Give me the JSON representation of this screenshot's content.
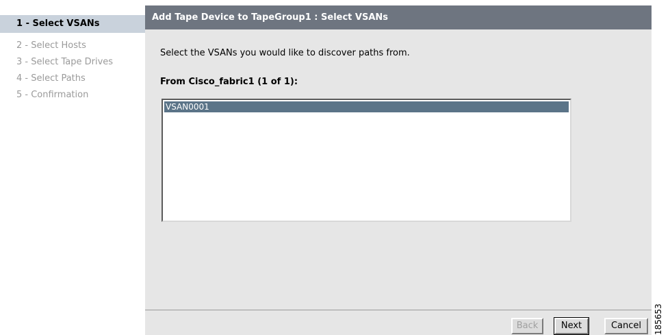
{
  "wizard": {
    "steps": [
      {
        "label": "1 - Select VSANs",
        "active": true
      },
      {
        "label": "2 - Select Hosts",
        "active": false
      },
      {
        "label": "3 - Select Tape Drives",
        "active": false
      },
      {
        "label": "4 - Select Paths",
        "active": false
      },
      {
        "label": "5 - Confirmation",
        "active": false
      }
    ]
  },
  "panel": {
    "title": "Add Tape Device to TapeGroup1 : Select VSANs",
    "instruction": "Select the VSANs you would like to discover paths from.",
    "fabric_label": "From Cisco_fabric1 (1 of 1):",
    "vsan_list": {
      "items": [
        {
          "label": "VSAN0001",
          "selected": true
        }
      ]
    }
  },
  "buttons": {
    "back": {
      "label": "Back",
      "enabled": false
    },
    "next": {
      "label": "Next",
      "enabled": true
    },
    "cancel": {
      "label": "Cancel",
      "enabled": true
    }
  },
  "figure_id": "185653",
  "colors": {
    "active_step_bg": "#c9d2dc",
    "header_bg": "#6e7580",
    "panel_bg": "#e6e6e6",
    "selection_bg": "#5b7488"
  }
}
